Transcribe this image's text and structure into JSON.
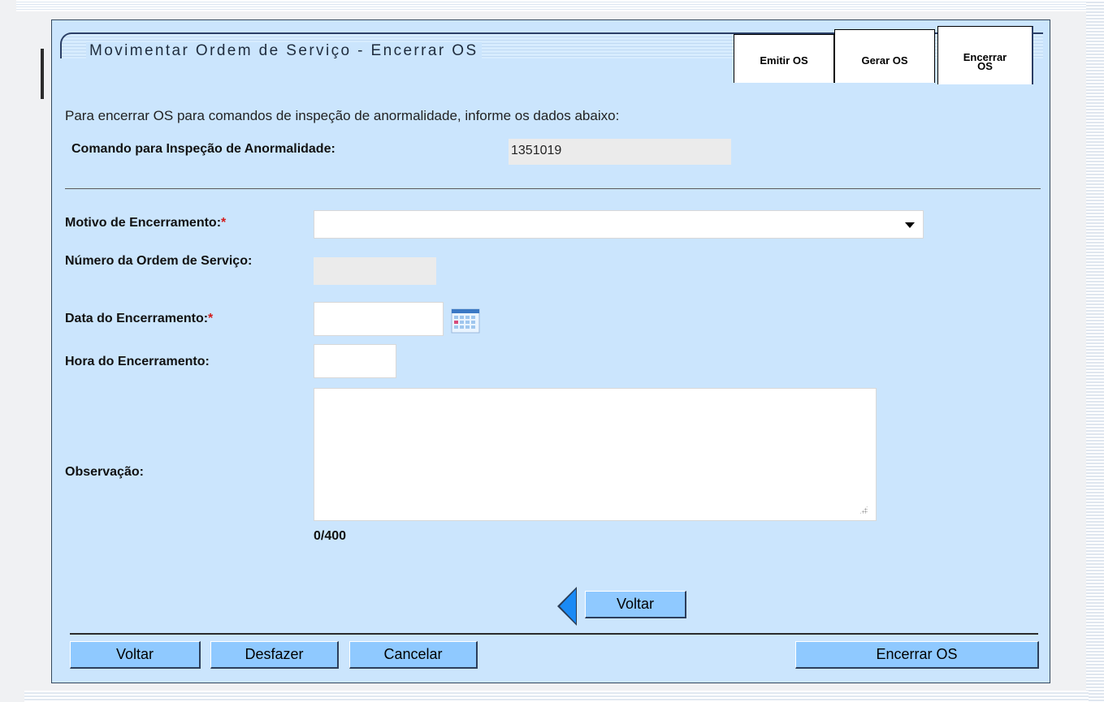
{
  "header": {
    "title": "Movimentar Ordem de Serviço - Encerrar OS",
    "tabs": [
      {
        "label": "Emitir OS"
      },
      {
        "label": "Gerar OS"
      },
      {
        "label": "Encerrar OS",
        "active": true
      }
    ]
  },
  "form": {
    "intro": "Para encerrar OS para comandos de inspeção de anormalidade, informe os dados abaixo:",
    "comando_label": "Comando para Inspeção de Anormalidade:",
    "comando_value": "1351019",
    "motivo_label": "Motivo de Encerramento:",
    "motivo_value": "",
    "numero_label": "Número da Ordem de Serviço:",
    "numero_value": "",
    "data_label": "Data do Encerramento:",
    "data_value": "",
    "hora_label": "Hora do Encerramento:",
    "hora_value": "",
    "observacao_label": "Observação:",
    "observacao_value": "",
    "counter": "0/400",
    "required_marker": "*"
  },
  "buttons": {
    "voltar_mid": "Voltar",
    "voltar": "Voltar",
    "desfazer": "Desfazer",
    "cancelar": "Cancelar",
    "encerrar": "Encerrar OS"
  },
  "colors": {
    "panel_bg": "#cbe5fd",
    "button_bg": "#8fc9ff",
    "required": "#d21c1c",
    "arrow": "#1a8af5"
  }
}
